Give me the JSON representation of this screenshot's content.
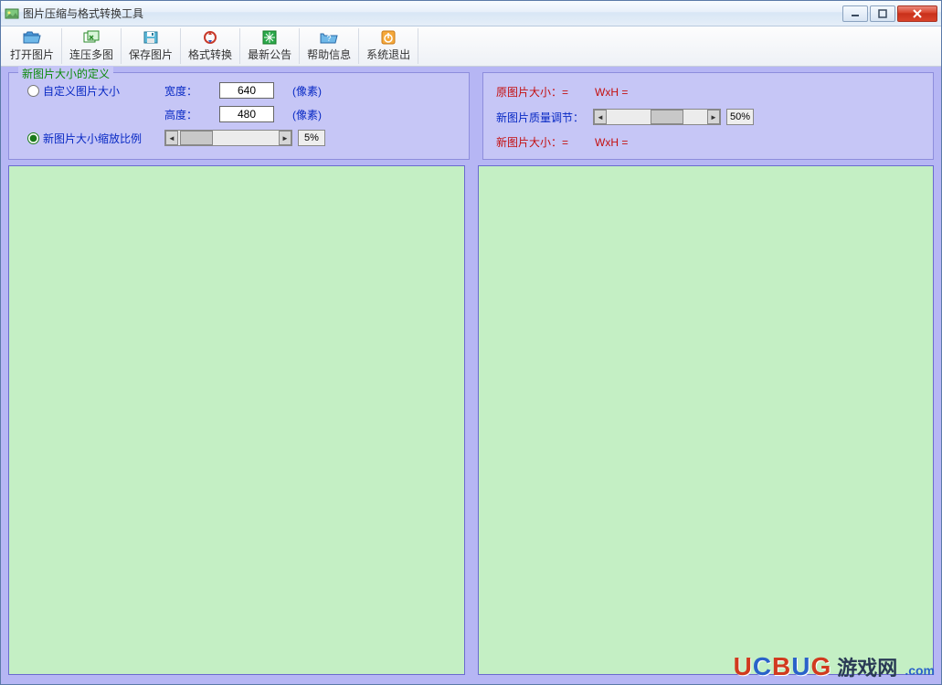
{
  "window": {
    "title": "图片压缩与格式转换工具"
  },
  "toolbar": {
    "open": "打开图片",
    "batch": "连压多图",
    "save": "保存图片",
    "convert": "格式转换",
    "news": "最新公告",
    "help": "帮助信息",
    "exit": "系统退出"
  },
  "left_panel": {
    "legend": "新图片大小的定义",
    "radio_custom": "自定义图片大小",
    "radio_scale": "新图片大小缩放比例",
    "width_label": "宽度：",
    "height_label": "高度：",
    "unit": "(像素)",
    "width_value": "640",
    "height_value": "480",
    "scale_pct": "5%"
  },
  "right_panel": {
    "orig_label": "原图片大小：=",
    "orig_val": "WxH =",
    "quality_label": "新图片质量调节：",
    "quality_pct": "50%",
    "new_label": "新图片大小：=",
    "new_val": "WxH ="
  },
  "watermark": {
    "main_u": "U",
    "main_c": "C",
    "main_b": "B",
    "main_u2": "U",
    "main_g": "G",
    "cn": "游戏网",
    "com": ".com"
  }
}
